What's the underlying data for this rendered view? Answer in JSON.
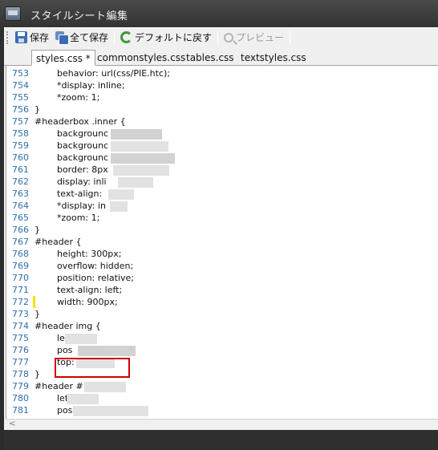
{
  "window": {
    "title": "スタイルシート編集"
  },
  "toolbar": {
    "save": "保存",
    "save_all": "全て保存",
    "reset_default": "デフォルトに戻す",
    "preview": "プレビュー"
  },
  "tabs": [
    {
      "label": "styles.css *",
      "active": true
    },
    {
      "label": "commonstyles.css",
      "active": false
    },
    {
      "label": "tables.css",
      "active": false
    },
    {
      "label": "textstyles.css",
      "active": false
    }
  ],
  "editor": {
    "lines": [
      {
        "num": "753",
        "text": "        behavior: url(css/PIE.htc);"
      },
      {
        "num": "754",
        "text": "        *display: inline;"
      },
      {
        "num": "755",
        "text": "        *zoom: 1;"
      },
      {
        "num": "756",
        "text": "}"
      },
      {
        "num": "757",
        "text": "#headerbox .inner {"
      },
      {
        "num": "758",
        "text": "        backgrounc"
      },
      {
        "num": "759",
        "text": "        backgrounc"
      },
      {
        "num": "760",
        "text": "        backgrounc"
      },
      {
        "num": "761",
        "text": "        border: 8px"
      },
      {
        "num": "762",
        "text": "        display: inli"
      },
      {
        "num": "763",
        "text": "        text-align:"
      },
      {
        "num": "764",
        "text": "        *display: in"
      },
      {
        "num": "765",
        "text": "        *zoom: 1;"
      },
      {
        "num": "766",
        "text": "}"
      },
      {
        "num": "767",
        "text": "#header {"
      },
      {
        "num": "768",
        "text": "        height: 300px;"
      },
      {
        "num": "769",
        "text": "        overflow: hidden;"
      },
      {
        "num": "770",
        "text": "        position: relative;"
      },
      {
        "num": "771",
        "text": "        text-align: left;"
      },
      {
        "num": "772",
        "text": "        width: 900px;"
      },
      {
        "num": "773",
        "text": "}"
      },
      {
        "num": "774",
        "text": "#header img {"
      },
      {
        "num": "775",
        "text": "        left:"
      },
      {
        "num": "776",
        "text": "        pos"
      },
      {
        "num": "777",
        "text": "        top:"
      },
      {
        "num": "778",
        "text": "}"
      },
      {
        "num": "779",
        "text": "#header #"
      },
      {
        "num": "780",
        "text": "        left:"
      },
      {
        "num": "781",
        "text": "        pos"
      }
    ]
  },
  "colors": {
    "line_number": "#2b6fb3",
    "change_marker": "#f2e600",
    "highlight_border": "#d00000"
  }
}
